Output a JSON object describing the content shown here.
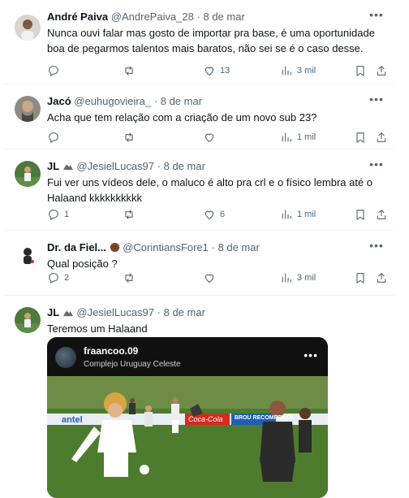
{
  "tweets": [
    {
      "name": "André Paiva",
      "handle": "@AndrePaiva_28",
      "date": "8 de mar",
      "text": "Nunca ouvi falar mas gosto de importar pra base, é uma oportunidade boa de pegarmos talentos mais baratos, não sei se é o caso desse.",
      "replies": "",
      "retweets": "",
      "likes": "13",
      "views": "3 mil"
    },
    {
      "name": "Jacó",
      "handle": "@euhugovieira_",
      "date": "8 de mar",
      "text": "Acha que tem relação com a criação de um novo sub 23?",
      "replies": "",
      "retweets": "",
      "likes": "",
      "views": "1 mil"
    },
    {
      "name": "JL",
      "handle": "@JesielLucas97",
      "date": "8 de mar",
      "text": "Fui ver uns vídeos dele, o maluco é alto pra crl e o físico lembra até o Halaand kkkkkkkkkk",
      "replies": "1",
      "retweets": "",
      "likes": "6",
      "views": "1 mil"
    },
    {
      "name": "Dr. da Fiel...",
      "handle": "@CorintiansFore1",
      "date": "8 de mar",
      "text": "Qual posição ?",
      "replies": "2",
      "retweets": "",
      "likes": "",
      "views": "3 mil"
    },
    {
      "name": "JL",
      "handle": "@JesielLucas97",
      "date": "8 de mar",
      "text": "Teremos um Halaand"
    }
  ],
  "media": {
    "username": "fraancoo.09",
    "location": "Complejo Uruguay Celeste",
    "banners": [
      "antel",
      "Coca-Cola",
      "BROU RECOMPENSA"
    ]
  },
  "dot": "·",
  "icons": [
    "reply-icon",
    "retweet-icon",
    "like-icon",
    "views-icon",
    "bookmark-icon",
    "share-icon",
    "more-icon"
  ]
}
